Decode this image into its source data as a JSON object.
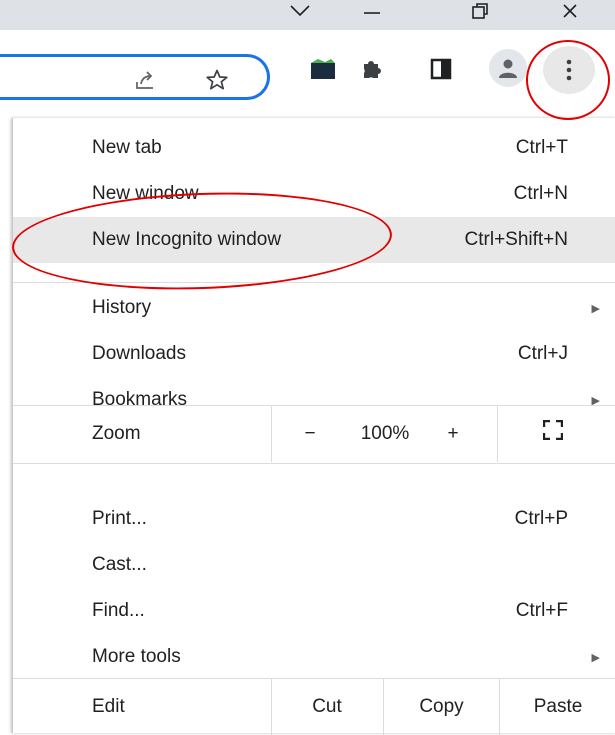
{
  "window_controls": {
    "dropdown_icon": "chevron-down-icon",
    "minimize_icon": "minimize-icon",
    "restore_icon": "restore-icon",
    "close_icon": "close-icon"
  },
  "toolbar": {
    "share_icon": "share-icon",
    "bookmark_icon": "star-icon",
    "extension_app_icon": "extension-app-icon",
    "extensions_icon": "puzzle-icon",
    "side_panel_icon": "side-panel-icon",
    "profile_icon": "profile-icon",
    "menu_icon": "three-dots-vertical-icon"
  },
  "menu": {
    "new_tab": {
      "label": "New tab",
      "shortcut": "Ctrl+T"
    },
    "new_window": {
      "label": "New window",
      "shortcut": "Ctrl+N"
    },
    "new_incognito": {
      "label": "New Incognito window",
      "shortcut": "Ctrl+Shift+N"
    },
    "history": {
      "label": "History"
    },
    "downloads": {
      "label": "Downloads",
      "shortcut": "Ctrl+J"
    },
    "bookmarks": {
      "label": "Bookmarks"
    },
    "zoom": {
      "label": "Zoom",
      "minus": "−",
      "value": "100%",
      "plus": "+"
    },
    "print": {
      "label": "Print...",
      "shortcut": "Ctrl+P"
    },
    "cast": {
      "label": "Cast..."
    },
    "find": {
      "label": "Find...",
      "shortcut": "Ctrl+F"
    },
    "more_tools": {
      "label": "More tools"
    },
    "edit": {
      "label": "Edit",
      "cut": "Cut",
      "copy": "Copy",
      "paste": "Paste"
    }
  },
  "colors": {
    "annotation": "#e00000",
    "hover_background": "#e8e8e8",
    "omnibox_focus": "#1a73e8"
  }
}
